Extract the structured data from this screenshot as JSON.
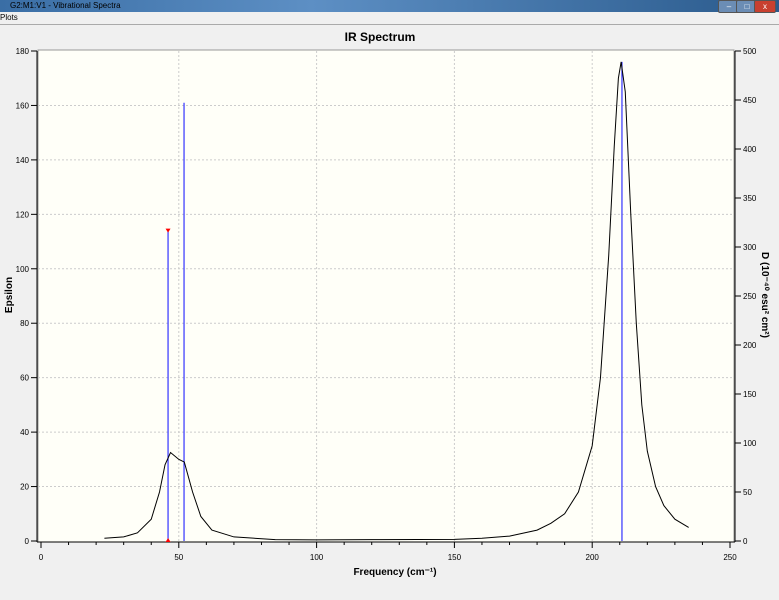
{
  "window": {
    "title": "G2:M1:V1 - Vibrational Spectra",
    "min": "–",
    "max": "□",
    "close": "x"
  },
  "menu": {
    "plots": "Plots"
  },
  "chart_data": {
    "type": "line",
    "title": "IR Spectrum",
    "xlabel": "Frequency (cm⁻¹)",
    "ylabel": "Epsilon",
    "y2label": "D (10⁻⁴⁰ esu² cm²)",
    "xlim": [
      0,
      250
    ],
    "ylim": [
      0,
      180
    ],
    "y2lim": [
      0,
      500
    ],
    "xticks": [
      0,
      50,
      100,
      150,
      200,
      250
    ],
    "yticks": [
      0,
      20,
      40,
      60,
      80,
      100,
      120,
      140,
      160,
      180
    ],
    "y2ticks": [
      0,
      50,
      100,
      150,
      200,
      250,
      300,
      350,
      400,
      450,
      500
    ],
    "grid": true,
    "curve": {
      "x": [
        23,
        30,
        35,
        40,
        43,
        45,
        47,
        50,
        52,
        55,
        58,
        62,
        70,
        85,
        100,
        120,
        150,
        160,
        170,
        180,
        185,
        190,
        195,
        200,
        203,
        206,
        208,
        209.5,
        210.5,
        212,
        214,
        216,
        218,
        220,
        223,
        226,
        230,
        235
      ],
      "y": [
        1,
        1.5,
        3,
        8,
        18,
        28,
        32.5,
        30,
        29,
        18,
        9,
        4,
        1.5,
        0.5,
        0.4,
        0.5,
        0.6,
        1,
        1.8,
        4,
        6.5,
        10,
        18,
        35,
        60,
        105,
        145,
        170,
        176,
        165,
        120,
        80,
        50,
        33,
        20,
        13,
        8,
        5
      ]
    },
    "sticks": {
      "x": [
        46.1,
        51.9,
        210.8
      ],
      "y": [
        114,
        161,
        176
      ],
      "selected": 0
    },
    "colors": {
      "curve": "#000000",
      "stick": "#3333ff",
      "selected": "#ff0000",
      "plot_bg": "#fffff8"
    }
  }
}
